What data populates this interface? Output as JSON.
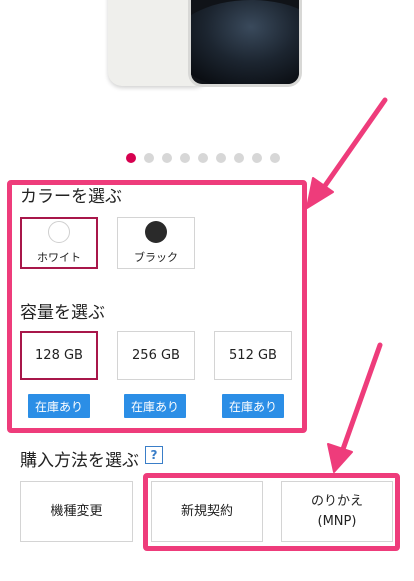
{
  "pager": {
    "count": 9,
    "active_index": 0
  },
  "color_section": {
    "title": "カラーを選ぶ",
    "options": [
      {
        "label": "ホワイト",
        "swatch": "#ffffff",
        "selected": true
      },
      {
        "label": "ブラック",
        "swatch": "#2a2a2a",
        "selected": false
      }
    ]
  },
  "capacity_section": {
    "title": "容量を選ぶ",
    "options": [
      {
        "label": "128 GB",
        "stock": "在庫あり",
        "selected": true
      },
      {
        "label": "256 GB",
        "stock": "在庫あり",
        "selected": false
      },
      {
        "label": "512 GB",
        "stock": "在庫あり",
        "selected": false
      }
    ]
  },
  "purchase_section": {
    "title": "購入方法を選ぶ",
    "help": "?",
    "options": [
      {
        "label": "機種変更"
      },
      {
        "label": "新規契約"
      },
      {
        "label": "のりかえ\n(MNP)"
      }
    ]
  },
  "colors": {
    "accent": "#d6004f",
    "selected_border": "#a8174a",
    "stock_badge": "#2b8ee6",
    "annotation": "#ee3c7b"
  }
}
